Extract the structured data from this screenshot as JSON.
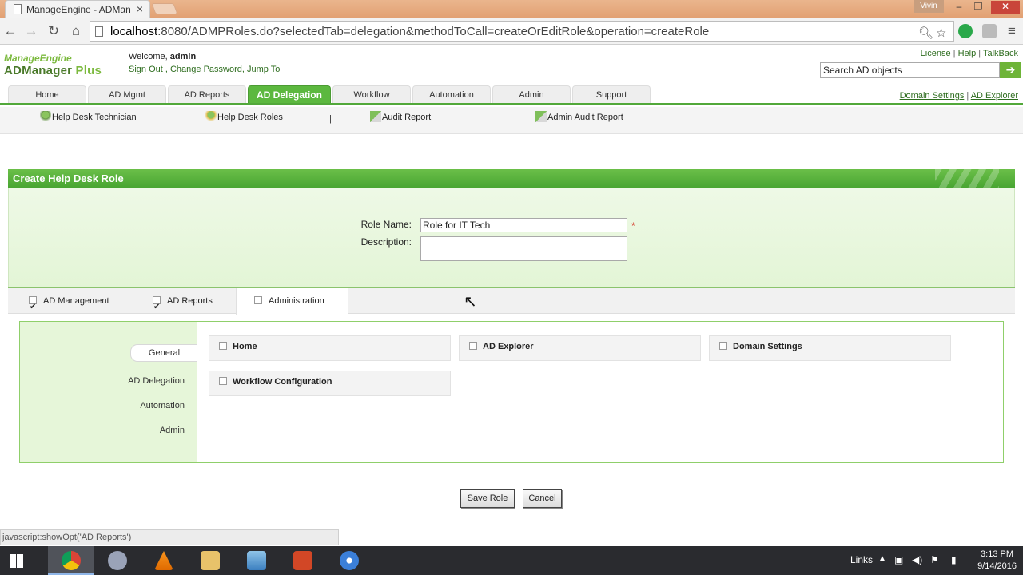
{
  "browser": {
    "tab_title": "ManageEngine - ADMana",
    "user": "Vivin",
    "url_host": "localhost",
    "url_rest": ":8080/ADMPRoles.do?selectedTab=delegation&methodToCall=createOrEditRole&operation=createRole",
    "status_text": "javascript:showOpt('AD Reports')"
  },
  "header": {
    "logo_top": "ManageEngine",
    "logo_main": "ADManager",
    "logo_plus": " Plus",
    "welcome": "Welcome, ",
    "user": "admin",
    "sign_out": "Sign Out",
    "change_password": "Change Password",
    "jump_to": "Jump To",
    "license": "License",
    "help": "Help",
    "talkback": "TalkBack",
    "search_placeholder": "Search AD objects"
  },
  "nav": {
    "tabs": [
      "Home",
      "AD Mgmt",
      "AD Reports",
      "AD Delegation",
      "Workflow",
      "Automation",
      "Admin",
      "Support"
    ],
    "domain_settings": "Domain Settings",
    "ad_explorer": "AD Explorer"
  },
  "subnav": {
    "items": [
      "Help Desk Technician",
      "Help Desk Roles",
      "Audit Report",
      "Admin Audit Report"
    ]
  },
  "form": {
    "title": "Create Help Desk Role",
    "role_name_label": "Role Name:",
    "role_name_value": "Role for  IT Tech",
    "required_mark": "*",
    "description_label": "Description:"
  },
  "perm_tabs": [
    "AD Management",
    "AD Reports",
    "Administration"
  ],
  "perm_side": [
    "General",
    "AD Delegation",
    "Automation",
    "Admin"
  ],
  "perm_options": [
    "Home",
    "AD Explorer",
    "Domain Settings",
    "Workflow Configuration"
  ],
  "buttons": {
    "save": "Save Role",
    "cancel": "Cancel"
  },
  "taskbar": {
    "links": "Links",
    "time": "3:13 PM",
    "date": "9/14/2016"
  },
  "colors": {
    "accent_green": "#5cb83f",
    "link_green": "#2e6d1f",
    "taskbar": "#2a2b2f"
  }
}
